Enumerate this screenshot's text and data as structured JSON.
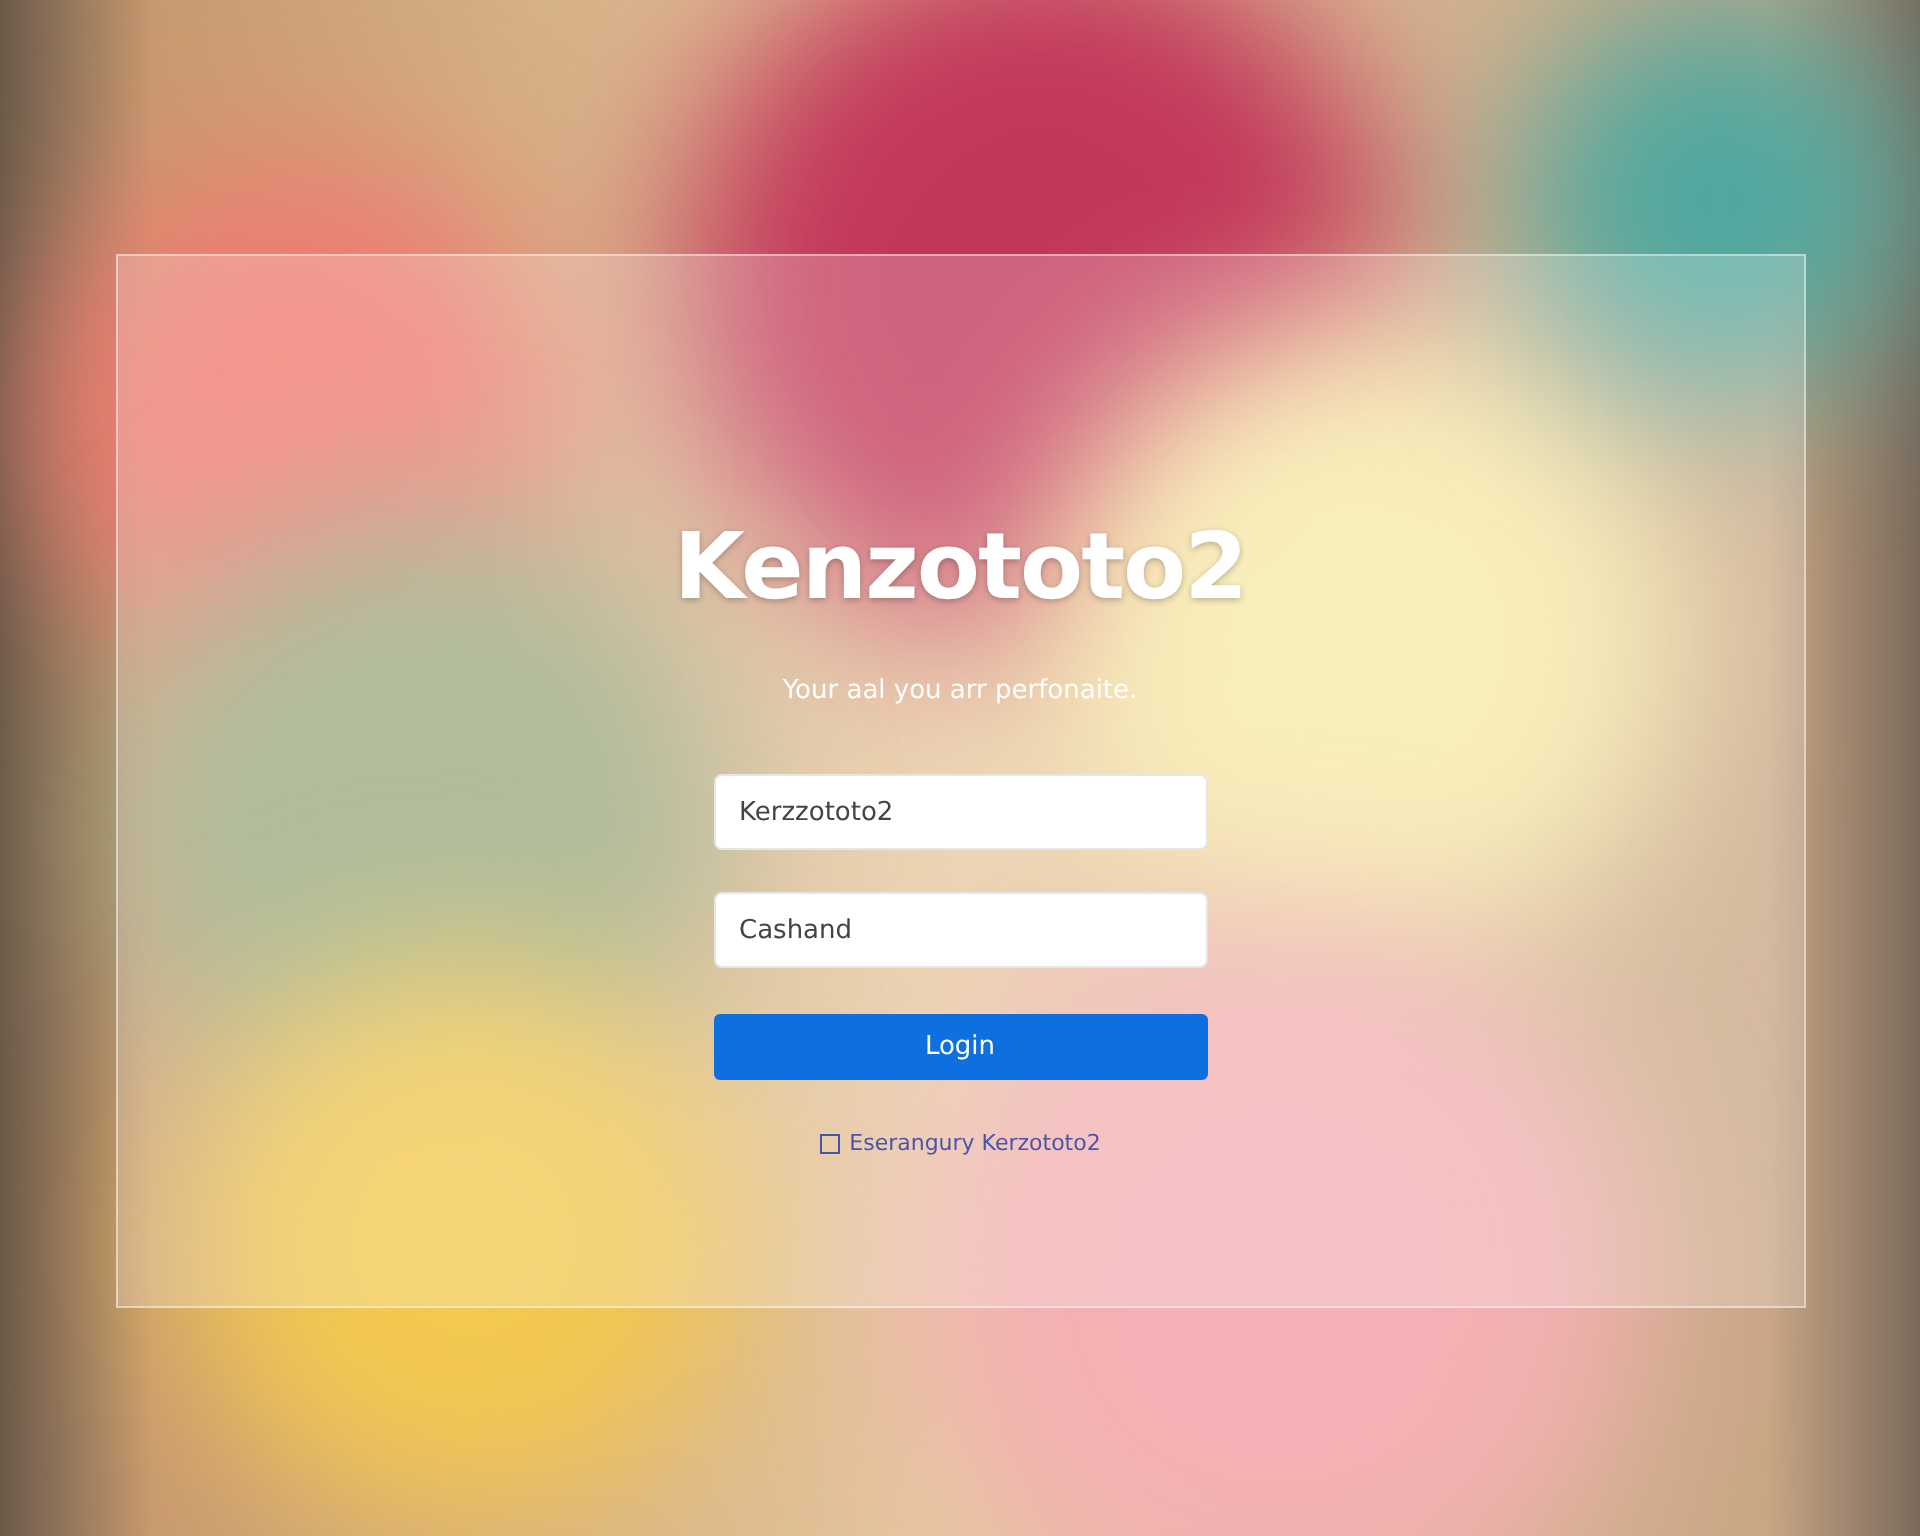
{
  "title": "Kenzototo2",
  "subtitle": "Your aal you arr perfonaite.",
  "fields": [
    {
      "value": "Kerzzototo2"
    },
    {
      "value": "Cashand"
    }
  ],
  "login_button": "Login",
  "remember": {
    "label": "Eserangury Kerzototo2",
    "checked": false
  }
}
